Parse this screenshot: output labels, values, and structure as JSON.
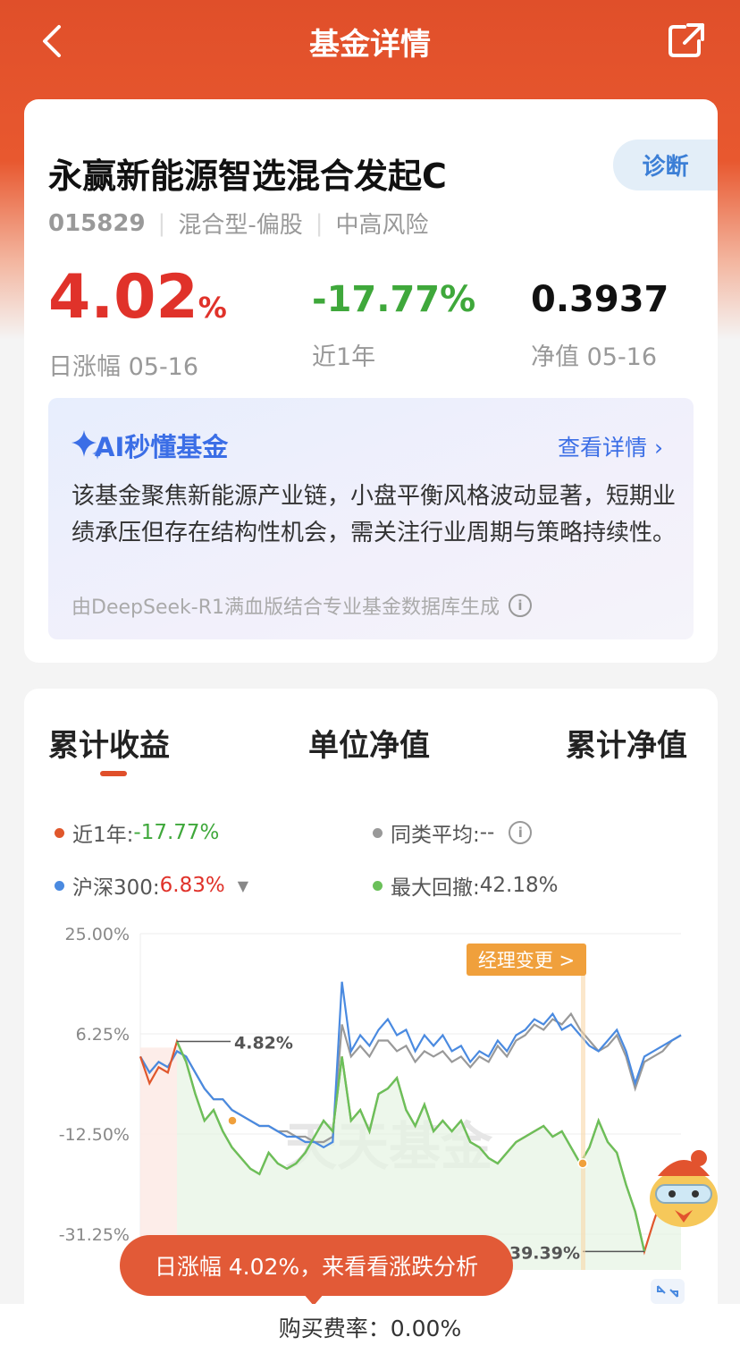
{
  "header": {
    "title": "基金详情"
  },
  "fund": {
    "name": "永赢新能源智选混合发起C",
    "diagnose_label": "诊断",
    "code": "015829",
    "type": "混合型-偏股",
    "risk": "中高风险",
    "daily_change": "4.02",
    "daily_change_unit": "%",
    "daily_label": "日涨幅 05-16",
    "year_change": "-17.77%",
    "year_label": "近1年",
    "nav": "0.3937",
    "nav_label": "净值 05-16"
  },
  "ai": {
    "title": "AI秒懂基金",
    "link": "查看详情 ",
    "text": "该基金聚焦新能源产业链，小盘平衡风格波动显著，短期业绩承压但存在结构性机会，需关注行业周期与策略持续性。",
    "footer": "由DeepSeek-R1满血版结合专业基金数据库生成"
  },
  "tabs": [
    "累计收益",
    "单位净值",
    "累计净值"
  ],
  "legend": {
    "fund_label": "近1年: ",
    "fund_value": "-17.77%",
    "peer_label": "同类平均: ",
    "peer_value": "--",
    "index_label": "沪深300: ",
    "index_value": "6.83%",
    "drawdown_label": "最大回撤: ",
    "drawdown_value": "42.18%"
  },
  "colors": {
    "brand": "#e04f2a",
    "up": "#e0322a",
    "down": "#3fa83b",
    "blue": "#4a8ae0",
    "grey": "#999999",
    "orange_tag": "#f0a03c"
  },
  "chart_data": {
    "type": "line",
    "y_ticks": [
      "25.00%",
      "6.25%",
      "-12.50%",
      "-31.25%"
    ],
    "ylim": [
      -31.25,
      25.0
    ],
    "annotations": [
      "4.82%",
      "39.39%"
    ],
    "manager_change_label": "经理变更 >",
    "watermark": "天天基金",
    "series": [
      {
        "name": "近1年",
        "color": "#e0572c",
        "values": [
          2,
          -3,
          0,
          -1,
          4.82,
          1,
          -5,
          -10,
          -8,
          -12,
          -15,
          -17,
          -19,
          -20,
          -16,
          -18,
          -19,
          -18,
          -16,
          -13,
          -10,
          -12,
          2,
          -10,
          -8,
          -12,
          -5,
          -4,
          -2,
          -8,
          -11,
          -7,
          -12,
          -10,
          -12,
          -10,
          -14,
          -15,
          -17,
          -18,
          -16,
          -14,
          -13,
          -12,
          -11,
          -13,
          -12,
          -15,
          -18,
          -15,
          -10,
          -14,
          -16,
          -22,
          -27,
          -34.5,
          -29,
          -24,
          -22,
          -19
        ]
      },
      {
        "name": "沪深300",
        "color": "#4a8ae0",
        "values": [
          2,
          -1,
          1,
          0,
          3,
          2,
          -1,
          -4,
          -6,
          -6,
          -8,
          -9,
          -10,
          -11,
          -11,
          -12,
          -13,
          -13,
          -14,
          -14,
          -15,
          -14,
          16,
          3,
          6,
          4,
          7,
          9,
          6,
          7,
          3,
          6,
          4,
          6,
          3,
          4,
          1,
          3,
          2,
          5,
          3,
          6,
          7,
          9,
          8,
          10,
          7,
          8,
          6,
          4,
          3,
          5,
          7,
          3,
          -3,
          2,
          3,
          4,
          5,
          6
        ]
      },
      {
        "name": "同类平均",
        "color": "#999999",
        "values": [
          2,
          -1,
          1,
          0,
          3,
          2,
          -1,
          -4,
          -6,
          -6,
          -8,
          -9,
          -10,
          -11,
          -11,
          -12,
          -12,
          -13,
          -13,
          -14,
          -14,
          -13,
          8,
          2,
          4,
          2,
          5,
          5,
          3,
          4,
          1,
          3,
          2,
          3,
          1,
          2,
          0,
          2,
          1,
          4,
          2,
          5,
          6,
          8,
          7,
          9,
          8,
          10,
          7,
          5,
          3,
          4,
          6,
          2,
          -4,
          1,
          2,
          3,
          5,
          6
        ]
      }
    ]
  },
  "bubble": "日涨幅 4.02%，来看看涨跌分析",
  "bottom": "购买费率：0.00%"
}
